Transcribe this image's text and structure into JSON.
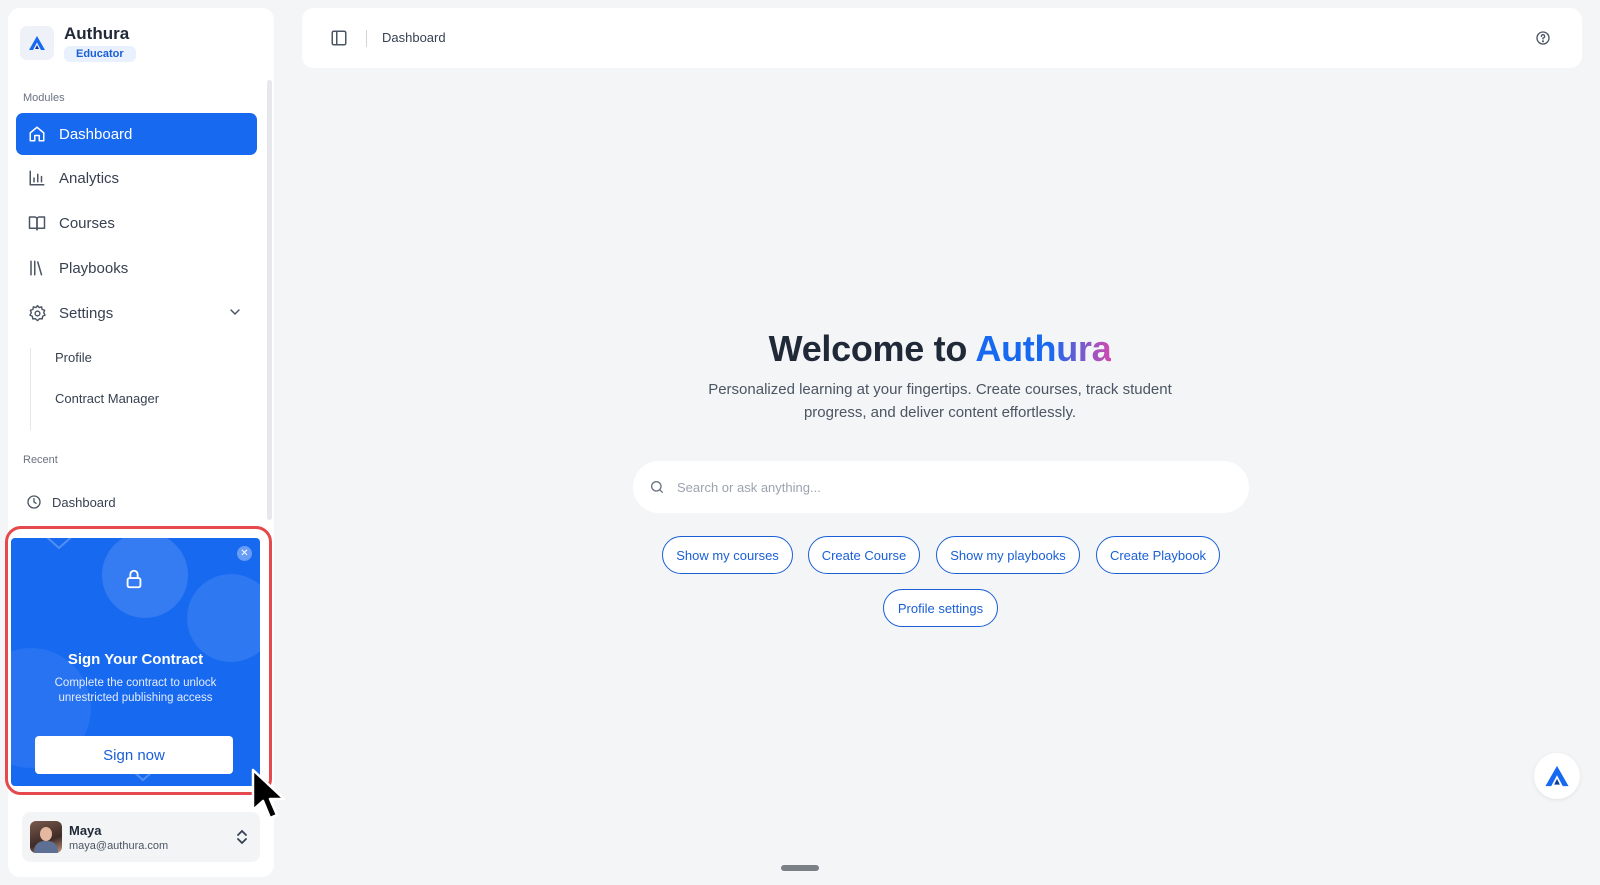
{
  "brand": {
    "name": "Authura",
    "role": "Educator"
  },
  "sidebar": {
    "modules_label": "Modules",
    "items": [
      {
        "label": "Dashboard",
        "icon": "home-icon",
        "active": true
      },
      {
        "label": "Analytics",
        "icon": "bar-chart-icon"
      },
      {
        "label": "Courses",
        "icon": "book-icon"
      },
      {
        "label": "Playbooks",
        "icon": "library-icon"
      },
      {
        "label": "Settings",
        "icon": "gear-icon"
      }
    ],
    "settings_sub": [
      {
        "label": "Profile"
      },
      {
        "label": "Contract Manager"
      }
    ],
    "recent_label": "Recent",
    "recent": [
      {
        "label": "Dashboard",
        "icon": "clock-icon"
      }
    ]
  },
  "promo": {
    "title": "Sign Your Contract",
    "description": "Complete the contract to unlock unrestricted publishing access",
    "button": "Sign now"
  },
  "user": {
    "name": "Maya",
    "email": "maya@authura.com"
  },
  "header": {
    "breadcrumb": "Dashboard"
  },
  "hero": {
    "title_prefix": "Welcome to ",
    "title_brand": "Authura",
    "subtitle": "Personalized learning at your fingertips. Create courses, track student progress, and deliver content effortlessly."
  },
  "search": {
    "placeholder": "Search or ask anything...",
    "value": ""
  },
  "chips": [
    {
      "label": "Show my courses"
    },
    {
      "label": "Create Course"
    },
    {
      "label": "Show my playbooks"
    },
    {
      "label": "Create Playbook"
    },
    {
      "label": "Profile settings"
    }
  ],
  "colors": {
    "accent": "#1769f0",
    "highlight_outline": "#e5484d",
    "brand_gradient_end": "#d14bb0"
  }
}
